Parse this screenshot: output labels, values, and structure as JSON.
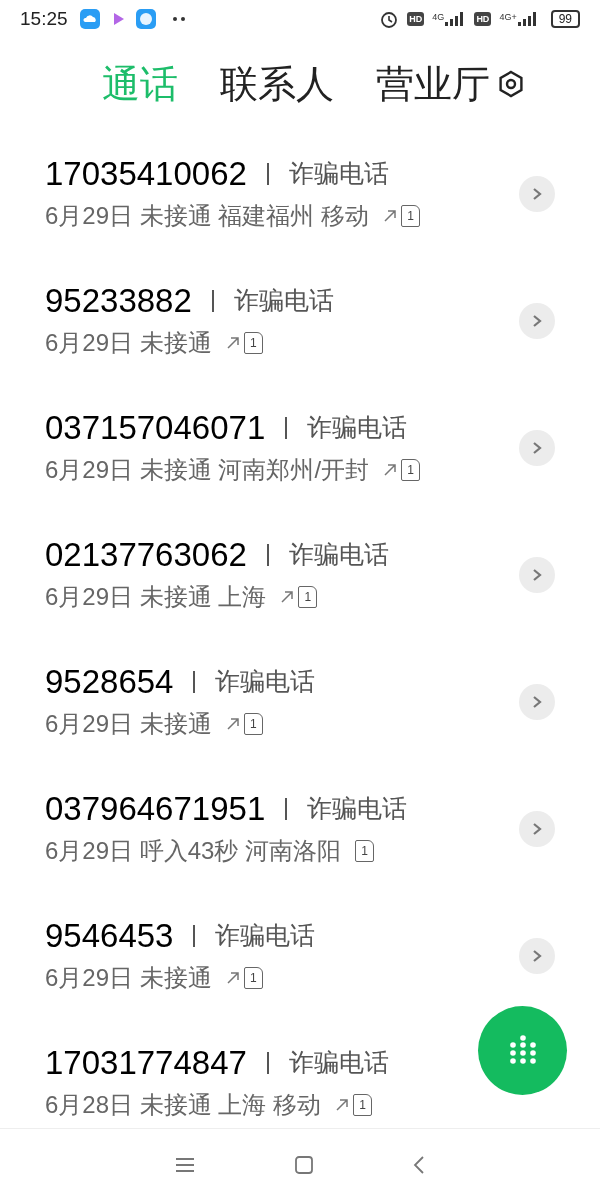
{
  "status_bar": {
    "time": "15:25",
    "sim1_tag": "HD",
    "sim1_network": "4G",
    "sim2_tag": "HD",
    "sim2_network": "4G+",
    "battery": "99"
  },
  "tabs": [
    {
      "label": "通话",
      "selected": true
    },
    {
      "label": "联系人",
      "selected": false
    },
    {
      "label": "营业厅",
      "selected": false
    }
  ],
  "calls": [
    {
      "number": "17035410062",
      "tag": "诈骗电话",
      "detail": "6月29日 未接通 福建福州 移动",
      "missed": true,
      "sim": "1"
    },
    {
      "number": "95233882",
      "tag": "诈骗电话",
      "detail": "6月29日 未接通",
      "missed": true,
      "sim": "1"
    },
    {
      "number": "037157046071",
      "tag": "诈骗电话",
      "detail": "6月29日 未接通 河南郑州/开封",
      "missed": true,
      "sim": "1"
    },
    {
      "number": "02137763062",
      "tag": "诈骗电话",
      "detail": "6月29日 未接通 上海",
      "missed": true,
      "sim": "1"
    },
    {
      "number": "9528654",
      "tag": "诈骗电话",
      "detail": "6月29日 未接通",
      "missed": true,
      "sim": "1"
    },
    {
      "number": "037964671951",
      "tag": "诈骗电话",
      "detail": "6月29日 呼入43秒 河南洛阳",
      "missed": false,
      "sim": "1"
    },
    {
      "number": "9546453",
      "tag": "诈骗电话",
      "detail": "6月29日 未接通",
      "missed": true,
      "sim": "1"
    },
    {
      "number": "17031774847",
      "tag": "诈骗电话",
      "detail": "6月28日 未接通 上海 移动",
      "missed": true,
      "sim": "1"
    }
  ]
}
